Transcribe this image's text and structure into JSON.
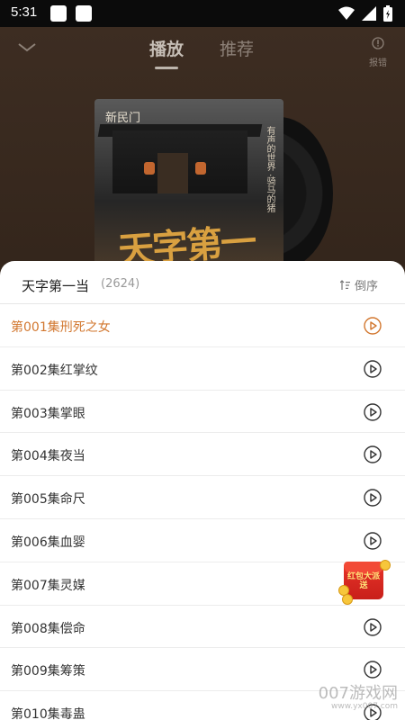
{
  "status_bar": {
    "time": "5:31"
  },
  "header": {
    "tabs": [
      {
        "label": "播放"
      },
      {
        "label": "推荐"
      }
    ],
    "report_label": "报错"
  },
  "album": {
    "cover_tag": "新民门",
    "cover_side_text": "有声的世界 ·骑马的猪",
    "cover_title": "天字第一当"
  },
  "playlist": {
    "title": "天字第一当",
    "count": "(2624)",
    "sort_label": "倒序",
    "episodes": [
      {
        "title": "第001集刑死之女"
      },
      {
        "title": "第002集红掌纹"
      },
      {
        "title": "第003集掌眼"
      },
      {
        "title": "第004集夜当"
      },
      {
        "title": "第005集命尺"
      },
      {
        "title": "第006集血婴"
      },
      {
        "title": "第007集灵媒"
      },
      {
        "title": "第008集偿命"
      },
      {
        "title": "第009集筹策"
      },
      {
        "title": "第010集毒蛊"
      }
    ]
  },
  "red_packet": {
    "label": "红包大派送"
  },
  "watermark": {
    "main": "007游戏网",
    "url": "www.yx007.com"
  },
  "colors": {
    "accent": "#d2772f",
    "header_bg": "#3a2a1f"
  }
}
